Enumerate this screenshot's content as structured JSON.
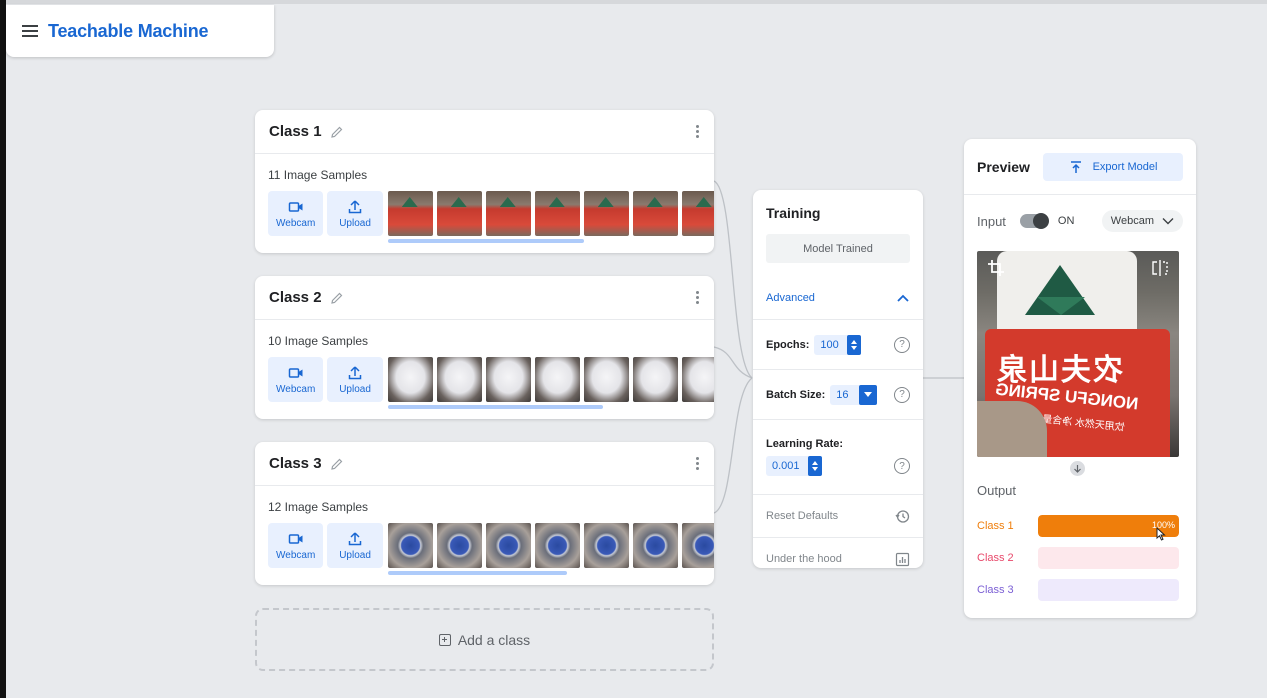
{
  "app": {
    "title": "Teachable Machine"
  },
  "classes": [
    {
      "name": "Class 1",
      "samples_label": "11 Image Samples",
      "thumb_kind": "bottle",
      "thumb_count": 7,
      "scroll_fraction": 0.6
    },
    {
      "name": "Class 2",
      "samples_label": "10 Image Samples",
      "thumb_kind": "box",
      "thumb_count": 7,
      "scroll_fraction": 0.66
    },
    {
      "name": "Class 3",
      "samples_label": "12 Image Samples",
      "thumb_kind": "watch",
      "thumb_count": 7,
      "scroll_fraction": 0.55
    }
  ],
  "sample_buttons": {
    "webcam": "Webcam",
    "upload": "Upload"
  },
  "add_class": {
    "label": "Add a class"
  },
  "training": {
    "title": "Training",
    "train_button": "Model Trained",
    "advanced_label": "Advanced",
    "epochs_label": "Epochs:",
    "epochs_value": "100",
    "batch_label": "Batch Size:",
    "batch_value": "16",
    "lr_label": "Learning Rate:",
    "lr_value": "0.001",
    "reset_label": "Reset Defaults",
    "hood_label": "Under the hood",
    "help_glyph": "?"
  },
  "preview": {
    "title": "Preview",
    "export_label": "Export Model",
    "input_label": "Input",
    "toggle_state": "ON",
    "source_select": "Webcam",
    "camera_text": {
      "brand_cn": "农夫山泉",
      "brand_en": "NONGFU SPRING",
      "sub_cn": "饮用天然水 净含量550ml"
    },
    "output_title": "Output",
    "outputs": [
      {
        "label": "Class 1",
        "percent": 100,
        "pct_text": "100%",
        "color": "#ef7e0b",
        "track": "#fde4cc"
      },
      {
        "label": "Class 2",
        "percent": 0,
        "pct_text": "",
        "color": "#e8496b",
        "track": "#fde8ec"
      },
      {
        "label": "Class 3",
        "percent": 0,
        "pct_text": "",
        "color": "#7b5fd4",
        "track": "#eeeafc"
      }
    ]
  },
  "colors": {
    "accent": "#1967d2",
    "background": "#e8eaed"
  }
}
